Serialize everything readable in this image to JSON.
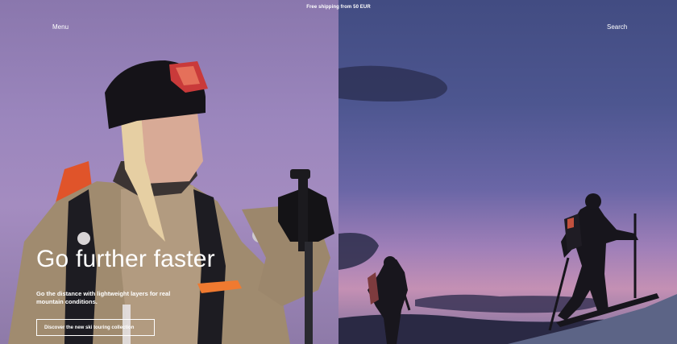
{
  "promo": {
    "text": "Free shipping from 50 EUR"
  },
  "nav": {
    "menu_label": "Menu",
    "search_label": "Search"
  },
  "hero": {
    "title": "Go further faster",
    "subtitle": "Go the distance with lightweight layers for real mountain conditions.",
    "cta_label": "Discover the new ski touring collection"
  }
}
